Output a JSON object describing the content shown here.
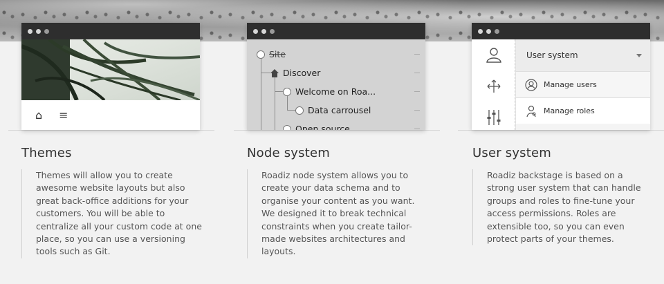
{
  "features": [
    {
      "title": "Themes",
      "description": "Themes will allow you to create awesome website layouts but also great back-office additions for your customers. You will be able to centralize all your custom code at one place, so you can use a versioning tools such as Git.",
      "toolbar": {
        "icons": [
          "home-icon",
          "menu-icon"
        ],
        "home_glyph": "⌂",
        "menu_glyph": "≡"
      }
    },
    {
      "title": "Node system",
      "description": "Roadiz node system allows you to create your data schema and to organise your content as you want. We designed it to break technical constraints when you create tailor-made websites architectures and layouts.",
      "tree": [
        "Site",
        "Discover",
        "Welcome on Roa...",
        "Data carrousel",
        "Open source"
      ]
    },
    {
      "title": "User system",
      "description": "Roadiz backstage is based on a strong user system that can handle groups and roles to fine-tune your access permissions. Roles are extensible too, so you can even protect parts of your themes.",
      "panel": {
        "header": "User system",
        "items": [
          "Manage users",
          "Manage roles"
        ]
      }
    }
  ],
  "colors": {
    "titlebar": "#2e2e2e",
    "background": "#f2f2f2",
    "node_panel": "#d3d3d3"
  }
}
